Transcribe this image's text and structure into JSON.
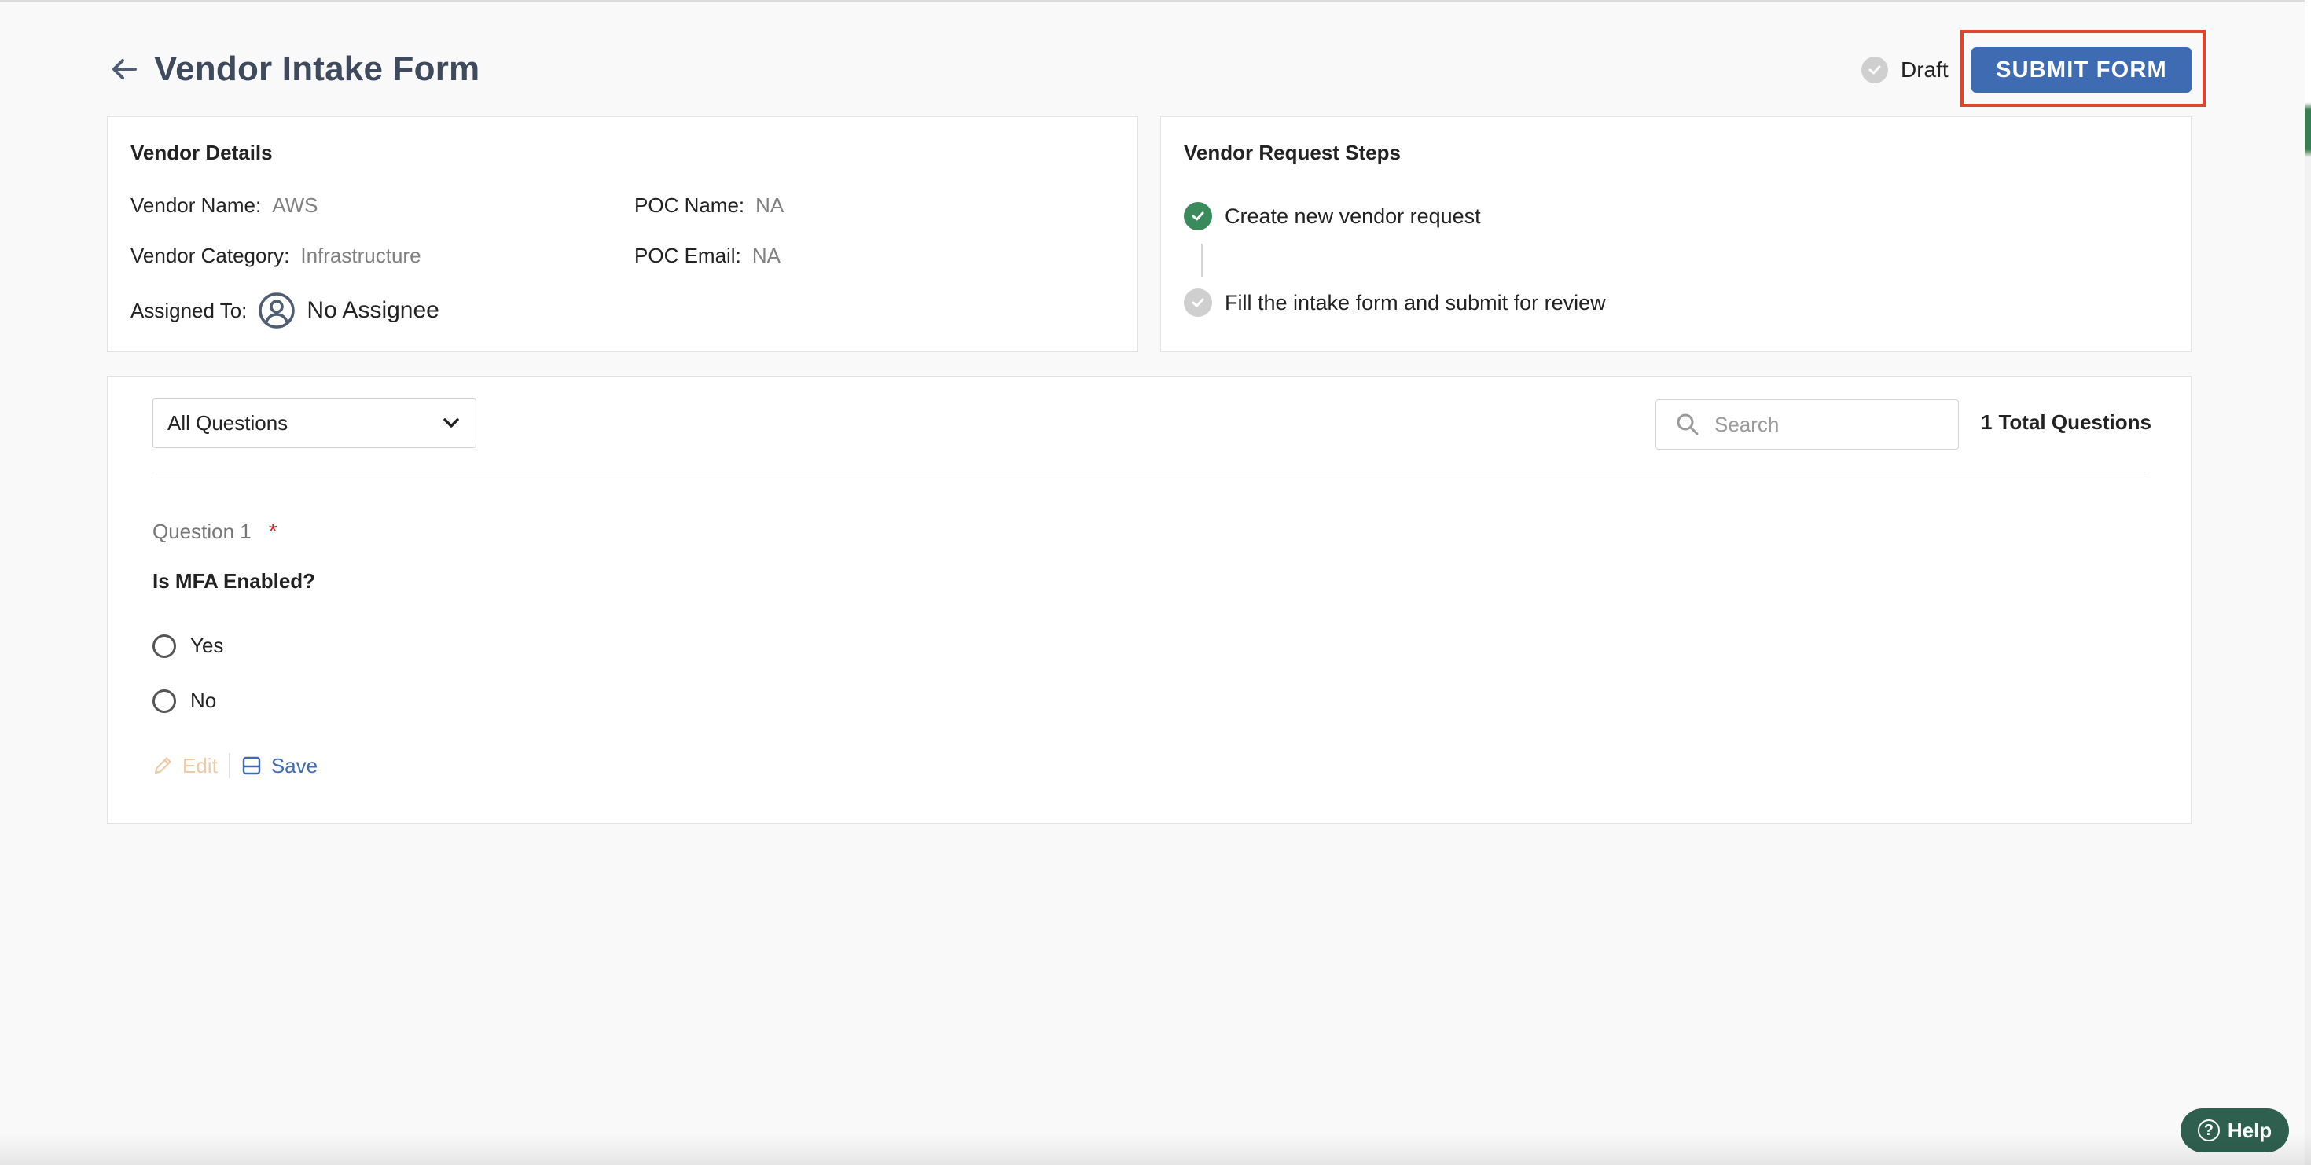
{
  "header": {
    "title": "Vendor Intake Form",
    "status": "Draft",
    "submit_label": "SUBMIT FORM",
    "back_icon": "arrow-left-icon"
  },
  "vendor_details": {
    "title": "Vendor Details",
    "vendor_name_label": "Vendor Name:",
    "vendor_name_value": "AWS",
    "vendor_category_label": "Vendor Category:",
    "vendor_category_value": "Infrastructure",
    "assigned_to_label": "Assigned To:",
    "assignee": "No Assignee",
    "poc_name_label": "POC Name:",
    "poc_name_value": "NA",
    "poc_email_label": "POC Email:",
    "poc_email_value": "NA"
  },
  "request_steps": {
    "title": "Vendor Request Steps",
    "steps": [
      {
        "label": "Create new vendor request",
        "status": "complete"
      },
      {
        "label": "Fill the intake form and submit for review",
        "status": "pending"
      }
    ]
  },
  "questions": {
    "filter_selected": "All Questions",
    "search_placeholder": "Search",
    "total_count": "1",
    "total_label": "Total Questions",
    "items": [
      {
        "label": "Question 1",
        "required_mark": "*",
        "text": "Is MFA Enabled?",
        "options": [
          "Yes",
          "No"
        ]
      }
    ],
    "edit_label": "Edit",
    "save_label": "Save"
  },
  "help": {
    "label": "Help",
    "icon_glyph": "?"
  },
  "colors": {
    "primary": "#3f6bb2",
    "success": "#3b8a5c",
    "highlight": "#e2432a",
    "help_bg": "#2f5f4f"
  }
}
